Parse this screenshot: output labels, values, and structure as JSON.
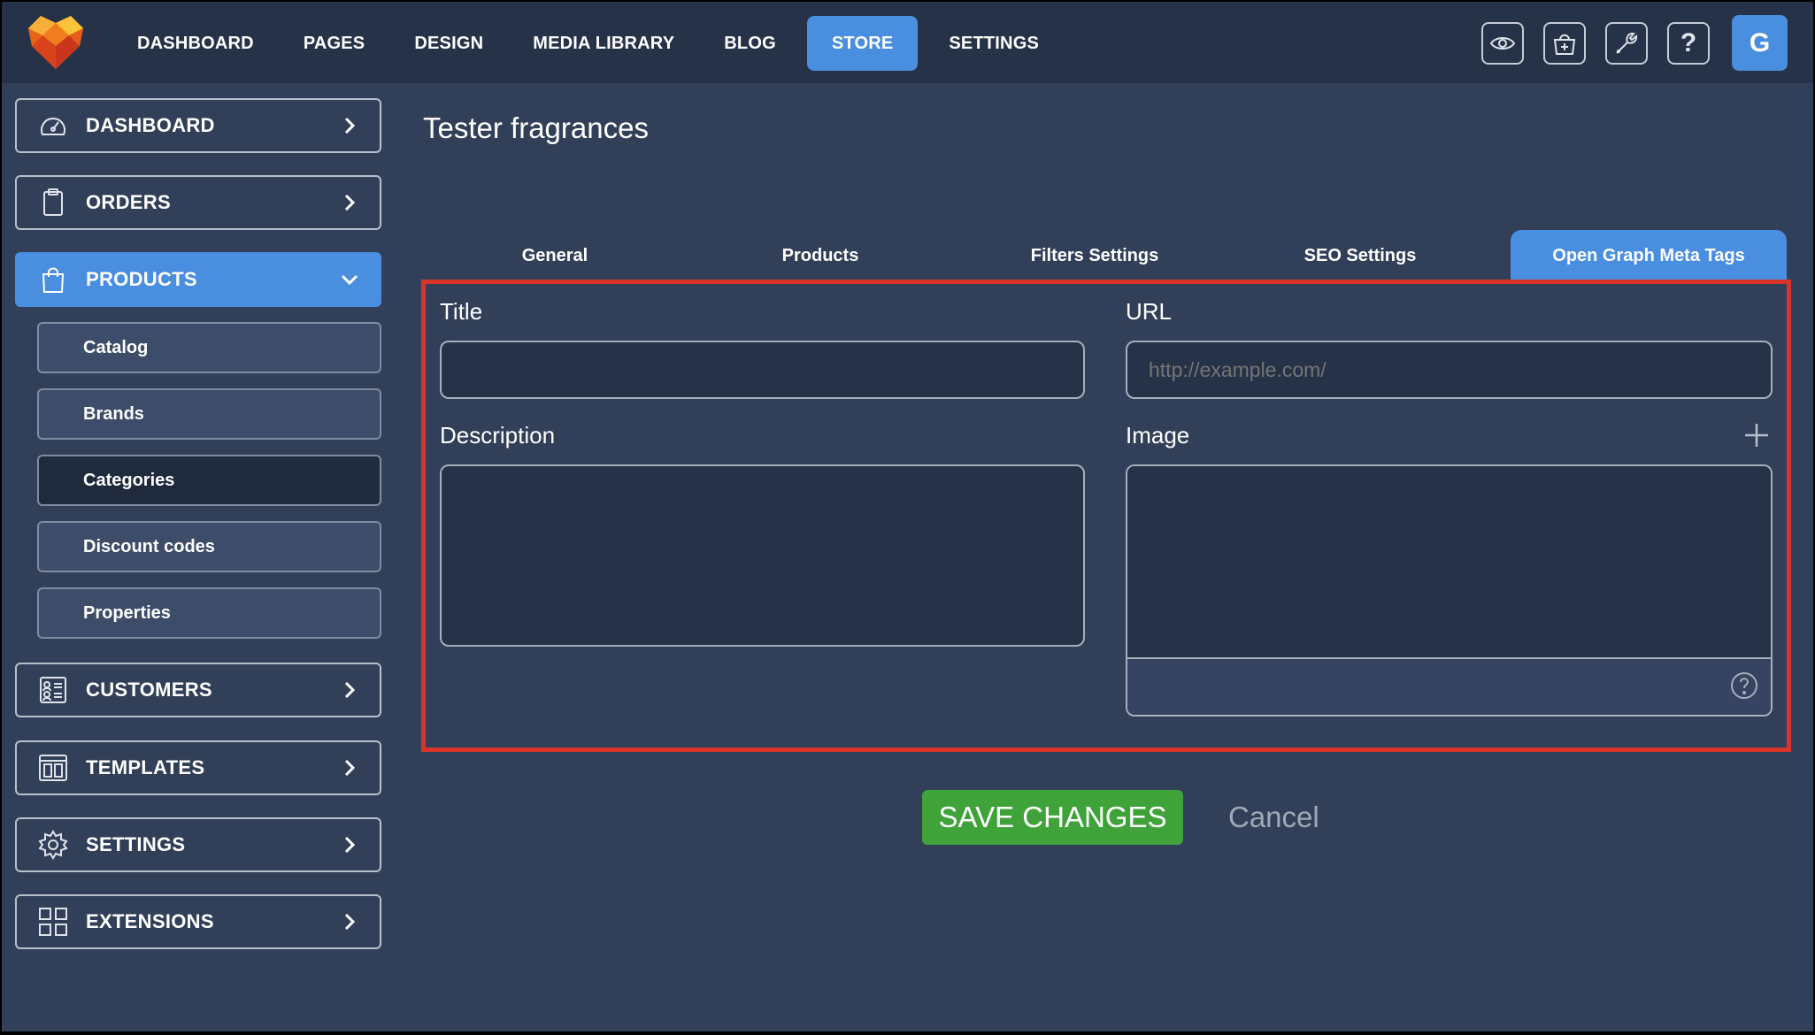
{
  "topnav": {
    "items": [
      {
        "label": "DASHBOARD"
      },
      {
        "label": "PAGES"
      },
      {
        "label": "DESIGN"
      },
      {
        "label": "MEDIA LIBRARY"
      },
      {
        "label": "BLOG"
      },
      {
        "label": "STORE",
        "active": true
      },
      {
        "label": "SETTINGS"
      }
    ],
    "icons": [
      "eye-icon",
      "basket-plus-icon",
      "wrench-icon",
      "question-icon"
    ],
    "avatar_letter": "G"
  },
  "sidebar": {
    "items": [
      {
        "label": "DASHBOARD",
        "icon": "gauge-icon"
      },
      {
        "label": "ORDERS",
        "icon": "clipboard-icon"
      },
      {
        "label": "PRODUCTS",
        "icon": "shopping-bag-icon",
        "active": true
      },
      {
        "label": "CUSTOMERS",
        "icon": "contacts-icon"
      },
      {
        "label": "TEMPLATES",
        "icon": "templates-icon"
      },
      {
        "label": "SETTINGS",
        "icon": "gear-icon"
      },
      {
        "label": "EXTENSIONS",
        "icon": "extensions-icon"
      }
    ],
    "sub_items": [
      {
        "label": "Catalog"
      },
      {
        "label": "Brands"
      },
      {
        "label": "Categories",
        "selected": true
      },
      {
        "label": "Discount codes"
      },
      {
        "label": "Properties"
      }
    ]
  },
  "main": {
    "title": "Tester fragrances",
    "tabs": [
      {
        "label": "General"
      },
      {
        "label": "Products"
      },
      {
        "label": "Filters Settings"
      },
      {
        "label": "SEO Settings"
      },
      {
        "label": "Open Graph Meta Tags",
        "active": true
      }
    ],
    "form": {
      "title_label": "Title",
      "title_value": "",
      "url_label": "URL",
      "url_placeholder": "http://example.com/",
      "description_label": "Description",
      "description_value": "",
      "image_label": "Image"
    },
    "save_label": "SAVE CHANGES",
    "cancel_label": "Cancel"
  },
  "colors": {
    "accent": "#4a8ee0",
    "save": "#3fa33a",
    "highlight_border": "#d9342a",
    "background": "#313f58",
    "topbar": "#263247"
  }
}
